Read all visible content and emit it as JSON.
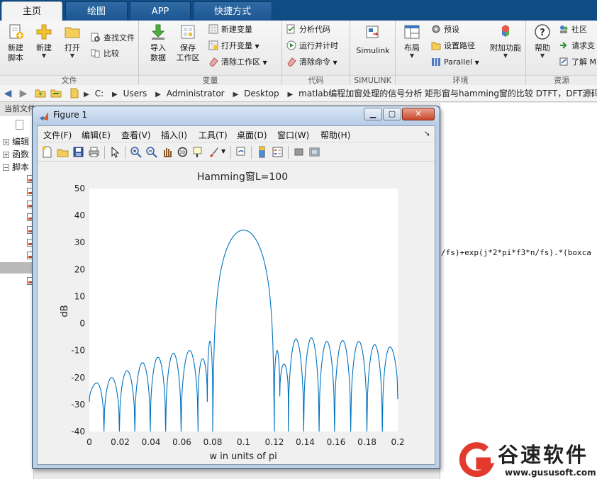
{
  "tabs": [
    {
      "label": "主页",
      "active": true
    },
    {
      "label": "绘图",
      "active": false
    },
    {
      "label": "APP",
      "active": false
    },
    {
      "label": "快捷方式",
      "active": false
    }
  ],
  "ribbon": {
    "file": {
      "label": "文件",
      "new_script": "新建\n脚本",
      "new": "新建",
      "open": "打开",
      "find_files": "查找文件",
      "compare": "比较"
    },
    "variable": {
      "label": "变量",
      "import": "导入\n数据",
      "save": "保存\n工作区",
      "new_var": "新建变量",
      "open_var": "打开变量",
      "clear_ws": "清除工作区"
    },
    "code": {
      "label": "代码",
      "analyze": "分析代码",
      "run_time": "运行并计时",
      "clear_cmd": "清除命令"
    },
    "simulink": {
      "label": "SIMULINK",
      "simulink": "Simulink"
    },
    "env": {
      "label": "环境",
      "layout": "布局",
      "prefs": "预设",
      "set_path": "设置路径",
      "parallel": "Parallel",
      "addons": "附加功能"
    },
    "resources": {
      "label": "资源",
      "help": "帮助",
      "community": "社区",
      "request": "请求支",
      "learn": "了解 M"
    }
  },
  "address": {
    "crumbs": [
      "C:",
      "Users",
      "Administrator",
      "Desktop",
      "matlab编程加窗处理的信号分析 矩形窗与hamming窗的比较 DTFT，DFT源码程序"
    ]
  },
  "left_pane": {
    "header": "当前文件夹",
    "items": [
      "编辑",
      "函数",
      "脚本"
    ]
  },
  "command_line": "/fs)+exp(j*2*pi*f3*n/fs).*(boxca",
  "watermark": {
    "title": "谷速软件",
    "url": "www.gususoft.com"
  },
  "figure": {
    "title": "Figure 1",
    "menu": [
      "文件(F)",
      "编辑(E)",
      "查看(V)",
      "插入(I)",
      "工具(T)",
      "桌面(D)",
      "窗口(W)",
      "帮助(H)"
    ]
  },
  "chart_data": {
    "type": "line",
    "title": "Hamming窗L=100",
    "xlabel": "w in units of pi",
    "ylabel": "dB",
    "xlim": [
      0,
      0.2
    ],
    "ylim": [
      -40,
      50
    ],
    "xticks": [
      "0",
      "0.02",
      "0.04",
      "0.06",
      "0.08",
      "0.1",
      "0.12",
      "0.14",
      "0.16",
      "0.18",
      "0.2"
    ],
    "yticks": [
      "50",
      "40",
      "30",
      "20",
      "10",
      "0",
      "-10",
      "-20",
      "-30",
      "-40"
    ],
    "line_color": "#0072bd",
    "grid": false,
    "main_lobe": {
      "center": 0.1,
      "peak_db": 34.6,
      "x_start": 0.08,
      "x_end": 0.12
    },
    "left_sidelobes": [
      {
        "x0": 0.0,
        "x1": 0.0095,
        "peak": -22
      },
      {
        "x0": 0.0095,
        "x1": 0.0195,
        "peak": -20
      },
      {
        "x0": 0.0195,
        "x1": 0.0295,
        "peak": -17.5
      },
      {
        "x0": 0.0295,
        "x1": 0.0395,
        "peak": -14.5
      },
      {
        "x0": 0.0395,
        "x1": 0.0495,
        "peak": -12.5
      },
      {
        "x0": 0.0495,
        "x1": 0.0595,
        "peak": -11
      },
      {
        "x0": 0.0595,
        "x1": 0.0705,
        "peak": -10
      },
      {
        "x0": 0.0705,
        "x1": 0.0765,
        "peak": -13,
        "min": -29
      },
      {
        "x0": 0.0765,
        "x1": 0.08,
        "peak": -6.5,
        "min": -29
      }
    ],
    "right_sidelobes": [
      {
        "x0": 0.12,
        "x1": 0.1235,
        "peak": -10,
        "min": -27
      },
      {
        "x0": 0.1235,
        "x1": 0.129,
        "peak": -15,
        "min": -27
      },
      {
        "x0": 0.129,
        "x1": 0.139,
        "peak": -5.8
      },
      {
        "x0": 0.139,
        "x1": 0.149,
        "peak": -5.3
      },
      {
        "x0": 0.149,
        "x1": 0.159,
        "peak": -6.6
      },
      {
        "x0": 0.159,
        "x1": 0.1695,
        "peak": -6.3
      },
      {
        "x0": 0.1695,
        "x1": 0.18,
        "peak": -6.6
      },
      {
        "x0": 0.18,
        "x1": 0.19,
        "peak": -7.8
      },
      {
        "x0": 0.19,
        "x1": 0.2,
        "peak": -8.7,
        "end": -28
      }
    ]
  }
}
